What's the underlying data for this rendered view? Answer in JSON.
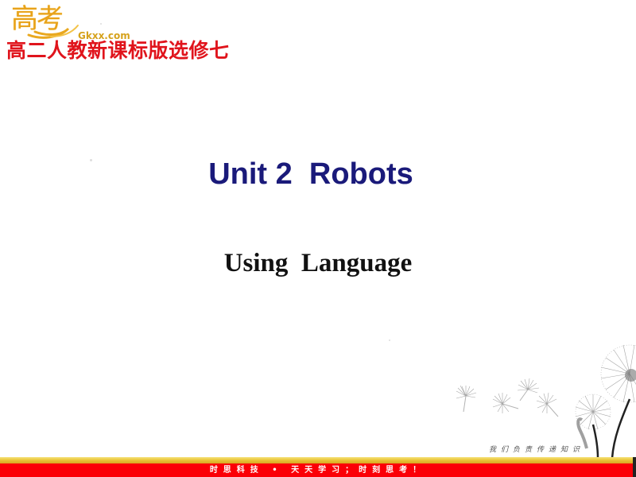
{
  "logo": {
    "chinese": "高考",
    "url_text": "Gkxx.com",
    "color": "#e8a21a"
  },
  "header": {
    "title": "高二人教新课标版选修七",
    "color": "#e0141c"
  },
  "slide": {
    "title": "Unit 2  Robots",
    "title_color": "#1a1a7a",
    "subtitle": "Using  Language"
  },
  "decoration": {
    "motto": "我们负责传递知识",
    "illustration": "dandelion-icon"
  },
  "footer": {
    "slogan": "时思科技 • 天天学习；时刻思考！",
    "band_color": "#fb0007",
    "stripe_color": "#eac63a"
  }
}
